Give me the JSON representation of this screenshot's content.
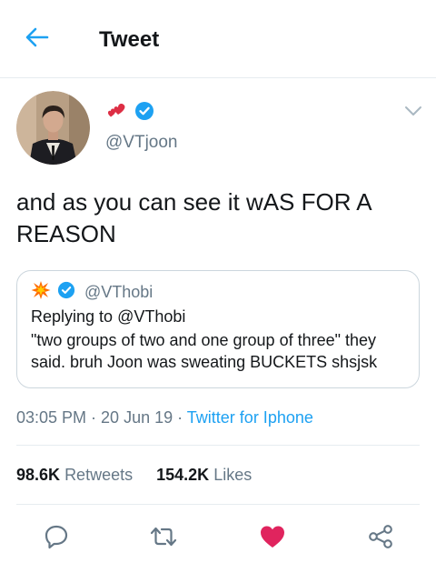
{
  "header": {
    "title": "Tweet"
  },
  "tweet": {
    "handle": "@VTjoon",
    "text": "and as you can see it wAS FOR A REASON",
    "name_emoji": "heart-emoji",
    "verified": true
  },
  "quote": {
    "handle": "@VThobi",
    "reply_prefix": "Replying to",
    "reply_to": "@VThobi",
    "text": "\"two groups of two and one group of three\" they said. bruh Joon was sweating BUCKETS shsjsk",
    "name_emoji": "boom-emoji",
    "verified": true
  },
  "meta": {
    "time": "03:05 PM",
    "sep1": " · ",
    "date": "20 Jun 19",
    "sep2": " · ",
    "source": "Twitter for Iphone"
  },
  "stats": {
    "retweets_count": "98.6K",
    "retweets_label": "Retweets",
    "likes_count": "154.2K",
    "likes_label": "Likes"
  },
  "actions": [
    "reply-icon",
    "retweet-icon",
    "like-icon",
    "share-icon"
  ],
  "colors": {
    "accent": "#1da1f2",
    "secondary_text": "#657786",
    "like": "#e0245e",
    "divider": "#e6ecf0"
  }
}
